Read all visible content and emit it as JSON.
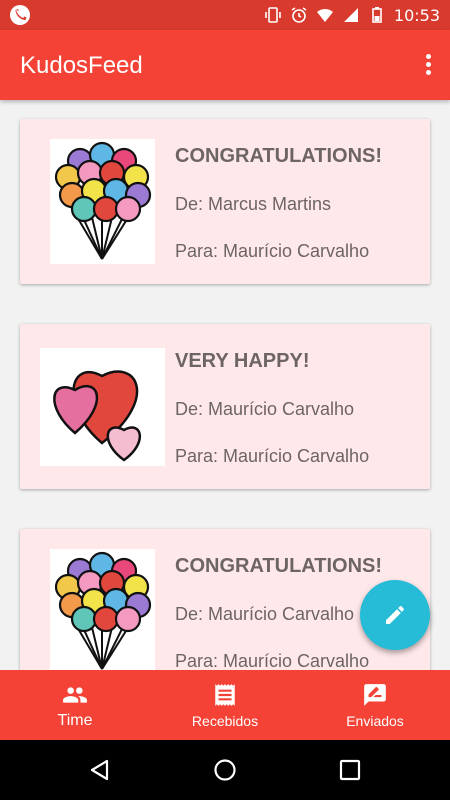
{
  "status_bar": {
    "time": "10:53"
  },
  "app_bar": {
    "title": "KudosFeed"
  },
  "cards": [
    {
      "title": "CONGRATULATIONS!",
      "from": "De: Marcus Martins",
      "to": "Para: Maurício Carvalho",
      "image": "balloons-image"
    },
    {
      "title": "VERY HAPPY!",
      "from": "De: Maurício Carvalho",
      "to": "Para: Maurício Carvalho",
      "image": "hearts-image"
    },
    {
      "title": "CONGRATULATIONS!",
      "from": "De: Maurício Carvalho",
      "to": "Para: Maurício Carvalho",
      "image": "balloons-image"
    }
  ],
  "bottom_nav": [
    {
      "label": "Time",
      "icon": "people-icon",
      "active": true
    },
    {
      "label": "Recebidos",
      "icon": "receipt-icon",
      "active": false
    },
    {
      "label": "Enviados",
      "icon": "feedback-icon",
      "active": false
    }
  ],
  "colors": {
    "primary": "#f44336",
    "status_bar": "#d83a2e",
    "card_bg": "#ffe8ea",
    "fab": "#26bcd7",
    "text": "#6d6464"
  },
  "fab": {
    "icon": "pencil-icon"
  }
}
